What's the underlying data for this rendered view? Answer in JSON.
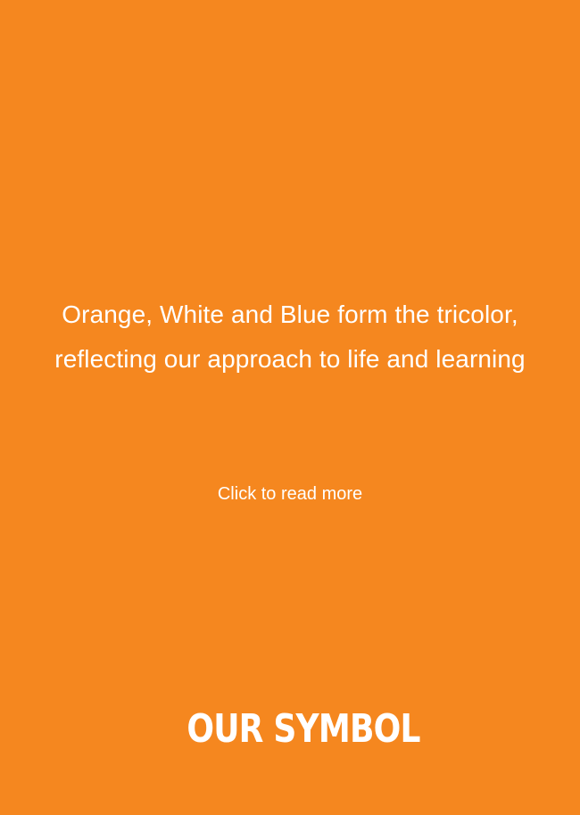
{
  "theme": {
    "background_color": "#f5871f",
    "text_color": "#ffffff"
  },
  "card": {
    "description": "Orange, White and Blue form the tricolor, reflecting our approach to life and learning",
    "read_more_label": "Click to read more",
    "title": "OUR SYMBOL"
  }
}
